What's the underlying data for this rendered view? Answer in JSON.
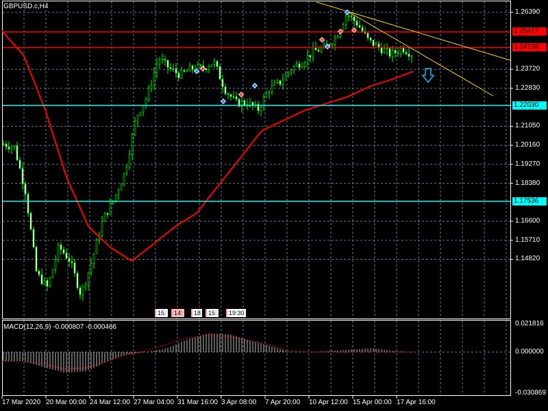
{
  "symbol_title": "GBPUSD.c,H4",
  "price_axis": [
    "1.26390",
    "1.23720",
    "1.22830",
    "1.21050",
    "1.20160",
    "1.19270",
    "1.18380",
    "1.16600",
    "1.15710",
    "1.14820"
  ],
  "price_axis_values": [
    1.2639,
    1.2372,
    1.2283,
    1.2105,
    1.2016,
    1.1927,
    1.1838,
    1.166,
    1.1571,
    1.1482
  ],
  "hlines": [
    {
      "label": "1.25477",
      "price": 1.25477,
      "color": "#ff0000"
    },
    {
      "label": "1.24738",
      "price": 1.24738,
      "color": "#ff0000"
    },
    {
      "label": "1.22030",
      "price": 1.2203,
      "color": "#00ffff"
    },
    {
      "label": "1.17536",
      "price": 1.17536,
      "color": "#00ffff"
    }
  ],
  "time_axis": [
    "17 Mar 2020",
    "20 Mar 00:00",
    "24 Mar 12:00",
    "27 Mar 04:00",
    "31 Mar 16:00",
    "3 Apr 08:00",
    "7 Apr 20:00",
    "10 Apr 12:00",
    "15 Apr 00:00",
    "17 Apr 16:00"
  ],
  "time_boxes": [
    "15:",
    "14:",
    "18",
    "15:",
    "19:30"
  ],
  "macd": {
    "title": "MACD(12,26,9) -0.000807 -0.000466",
    "axis": [
      "0.021816",
      "0.000000",
      "-0.030869"
    ]
  },
  "chart_data": {
    "type": "candlestick",
    "price_keypoints": [
      1.2023,
      1.2007,
      1.1798,
      1.1413,
      1.1349,
      1.1541,
      1.1477,
      1.1316,
      1.1477,
      1.167,
      1.1766,
      1.1894,
      1.2151,
      1.2247,
      1.2424,
      1.2376,
      1.2344,
      1.2376,
      1.2376,
      1.2408,
      1.2279,
      1.2215,
      1.2215,
      1.2183,
      1.2279,
      1.2312,
      1.2376,
      1.2408,
      1.2456,
      1.2472,
      1.252,
      1.2633,
      1.2584,
      1.2504,
      1.2472,
      1.244,
      1.2472,
      1.244
    ],
    "ma_keypoints": [
      1.255,
      1.2438,
      1.2181,
      1.186,
      1.1635,
      1.1538,
      1.1474,
      1.1554,
      1.1635,
      1.1699,
      1.1827,
      1.1955,
      1.2084,
      1.2132,
      1.218,
      1.2212,
      1.2244,
      1.2292,
      1.2324,
      1.2362
    ],
    "macd_hist_keypoints": [
      -0.007,
      -0.007,
      -0.012,
      -0.016,
      -0.015,
      -0.008,
      -0.002,
      0.0,
      0.003,
      0.01,
      0.0145,
      0.014,
      0.009,
      0.005,
      0.0,
      0.0,
      0.001,
      0.002,
      0.003,
      0.001,
      0.0
    ],
    "macd_signal_keypoints": [
      -0.007,
      -0.0075,
      -0.009,
      -0.013,
      -0.0125,
      -0.008,
      -0.002,
      0.001,
      0.006,
      0.011,
      0.013,
      0.012,
      0.009,
      0.006,
      0.001,
      0.0,
      0.0,
      0.0,
      0.0,
      0.0,
      0.0
    ]
  }
}
